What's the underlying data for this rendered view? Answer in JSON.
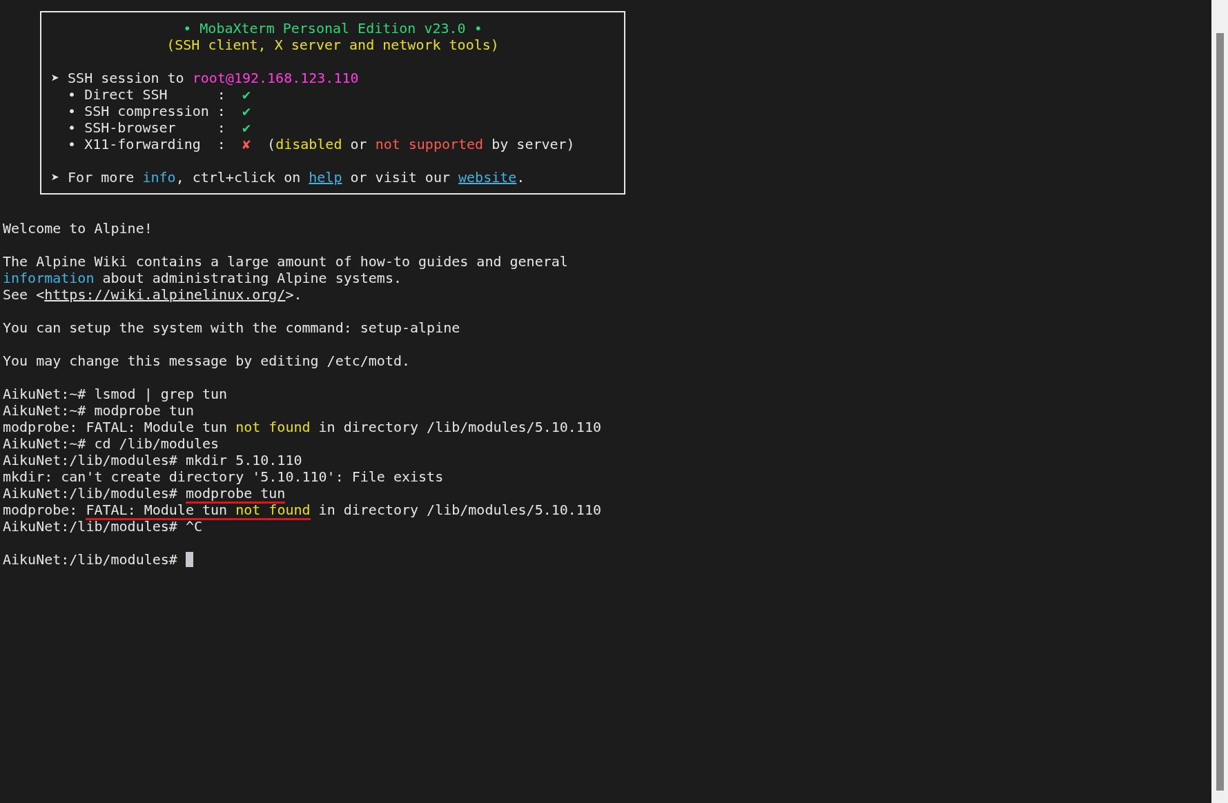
{
  "banner": {
    "lines": [
      {
        "kind": "centered",
        "segments": [
          {
            "text": "• MobaXterm Personal Edition v23.0 •",
            "kind": "green"
          }
        ]
      },
      {
        "kind": "centered",
        "segments": [
          {
            "text": "(SSH client, X server and network tools)",
            "kind": "yellow"
          }
        ]
      },
      {
        "kind": "blank"
      },
      {
        "kind": "text",
        "segments": [
          {
            "text": "➤ SSH session to ",
            "kind": "plain"
          },
          {
            "text": "root@192.168.123.110",
            "kind": "magenta"
          }
        ]
      },
      {
        "kind": "text",
        "segments": [
          {
            "text": "  • Direct SSH      :  ",
            "kind": "plain"
          },
          {
            "text": "✔",
            "kind": "green"
          }
        ]
      },
      {
        "kind": "text",
        "segments": [
          {
            "text": "  • SSH compression :  ",
            "kind": "plain"
          },
          {
            "text": "✔",
            "kind": "green"
          }
        ]
      },
      {
        "kind": "text",
        "segments": [
          {
            "text": "  • SSH-browser     :  ",
            "kind": "plain"
          },
          {
            "text": "✔",
            "kind": "green"
          }
        ]
      },
      {
        "kind": "text",
        "segments": [
          {
            "text": "  • X11-forwarding  :  ",
            "kind": "plain"
          },
          {
            "text": "✘",
            "kind": "red"
          },
          {
            "text": "  (",
            "kind": "plain"
          },
          {
            "text": "disabled",
            "kind": "yellow"
          },
          {
            "text": " or ",
            "kind": "plain"
          },
          {
            "text": "not supported",
            "kind": "red"
          },
          {
            "text": " by server)",
            "kind": "plain"
          }
        ]
      },
      {
        "kind": "blank"
      },
      {
        "kind": "text",
        "segments": [
          {
            "text": "➤ For more ",
            "kind": "plain"
          },
          {
            "text": "info",
            "kind": "cyan"
          },
          {
            "text": ", ctrl+click on ",
            "kind": "plain"
          },
          {
            "text": "help",
            "kind": "link"
          },
          {
            "text": " or visit our ",
            "kind": "plain"
          },
          {
            "text": "website",
            "kind": "link"
          },
          {
            "text": ".",
            "kind": "plain"
          }
        ]
      }
    ]
  },
  "lines": [
    {
      "kind": "text",
      "segments": [
        {
          "text": "Welcome to Alpine!",
          "kind": "plain",
          "marked": false
        }
      ]
    },
    {
      "kind": "blank"
    },
    {
      "kind": "text",
      "segments": [
        {
          "text": "The Alpine Wiki contains a large amount of how-to guides and general",
          "kind": "plain",
          "marked": false
        }
      ]
    },
    {
      "kind": "text",
      "segments": [
        {
          "text": "information",
          "kind": "cyan",
          "marked": false
        },
        {
          "text": " about administrating Alpine systems.",
          "kind": "plain",
          "marked": false
        }
      ]
    },
    {
      "kind": "text",
      "segments": [
        {
          "text": "See <",
          "kind": "plain",
          "marked": false
        },
        {
          "text": "https://wiki.alpinelinux.org/",
          "kind": "url",
          "marked": false
        },
        {
          "text": ">.",
          "kind": "plain",
          "marked": false
        }
      ]
    },
    {
      "kind": "blank"
    },
    {
      "kind": "text",
      "segments": [
        {
          "text": "You can setup the system with the command: setup-alpine",
          "kind": "plain",
          "marked": false
        }
      ]
    },
    {
      "kind": "blank"
    },
    {
      "kind": "text",
      "segments": [
        {
          "text": "You may change this message by editing /etc/motd.",
          "kind": "plain",
          "marked": false
        }
      ]
    },
    {
      "kind": "blank"
    },
    {
      "kind": "text",
      "segments": [
        {
          "text": "AikuNet:~# lsmod | grep tun",
          "kind": "plain",
          "marked": false
        }
      ]
    },
    {
      "kind": "text",
      "segments": [
        {
          "text": "AikuNet:~# modprobe tun",
          "kind": "plain",
          "marked": false
        }
      ]
    },
    {
      "kind": "text",
      "segments": [
        {
          "text": "modprobe: FATAL: Module tun ",
          "kind": "plain",
          "marked": false
        },
        {
          "text": "not found",
          "kind": "yellow",
          "marked": false
        },
        {
          "text": " in directory /lib/modules/5.10.110",
          "kind": "plain",
          "marked": false
        }
      ]
    },
    {
      "kind": "text",
      "segments": [
        {
          "text": "AikuNet:~# cd /lib/modules",
          "kind": "plain",
          "marked": false
        }
      ]
    },
    {
      "kind": "text",
      "segments": [
        {
          "text": "AikuNet:/lib/modules# mkdir 5.10.110",
          "kind": "plain",
          "marked": false
        }
      ]
    },
    {
      "kind": "text",
      "segments": [
        {
          "text": "mkdir: can't create directory '5.10.110': File exists",
          "kind": "plain",
          "marked": false
        }
      ]
    },
    {
      "kind": "text",
      "segments": [
        {
          "text": "AikuNet:/lib/modules# ",
          "kind": "plain",
          "marked": false
        },
        {
          "text": "modprobe tun",
          "kind": "plain",
          "marked": true
        }
      ]
    },
    {
      "kind": "text",
      "segments": [
        {
          "text": "modprobe: ",
          "kind": "plain",
          "marked": false
        },
        {
          "text": "FATAL: Module tun ",
          "kind": "plain",
          "marked": true
        },
        {
          "text": "not found",
          "kind": "yellow",
          "marked": true
        },
        {
          "text": " in directory /lib/modules/5.10.110",
          "kind": "plain",
          "marked": false
        }
      ]
    },
    {
      "kind": "text",
      "segments": [
        {
          "text": "AikuNet:/lib/modules# ^C",
          "kind": "plain",
          "marked": false
        }
      ]
    },
    {
      "kind": "blank"
    },
    {
      "kind": "text",
      "segments": [
        {
          "text": "AikuNet:/lib/modules# ",
          "kind": "plain",
          "marked": false
        }
      ]
    }
  ],
  "cursor_visible": true
}
